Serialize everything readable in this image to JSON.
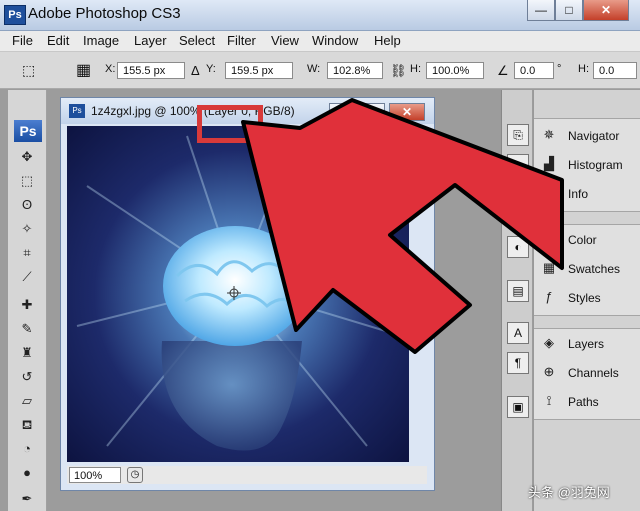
{
  "app": {
    "title": "Adobe Photoshop CS3",
    "logo": "Ps"
  },
  "window_controls": {
    "minimize": "—",
    "maximize": "□",
    "close": "✕"
  },
  "menu": [
    "File",
    "Edit",
    "Image",
    "Layer",
    "Select",
    "Filter",
    "View",
    "Window",
    "Help"
  ],
  "options": {
    "x_label": "X:",
    "x_value": "155.5 px",
    "y_label": "Y:",
    "y_value": "159.5 px",
    "w_label": "W:",
    "w_value": "102.8%",
    "h_label": "H:",
    "h_value": "100.0%",
    "angle_value": "0.0",
    "angle_unit": "°",
    "hskew_label": "H:",
    "hskew_value": "0.0"
  },
  "toolbox": {
    "badge": "Ps"
  },
  "document": {
    "title": "1z4zgxl.jpg @ 100% (Layer 0, RGB/8)",
    "zoom": "100%"
  },
  "panels": {
    "group1": [
      "Navigator",
      "Histogram",
      "Info"
    ],
    "group2": [
      "Color",
      "Swatches",
      "Styles"
    ],
    "group3": [
      "Layers",
      "Channels",
      "Paths"
    ]
  },
  "watermark": "头条 @羽兔网",
  "colors": {
    "highlight": "#d83a3a",
    "ps_blue": "#1e4f9c"
  }
}
